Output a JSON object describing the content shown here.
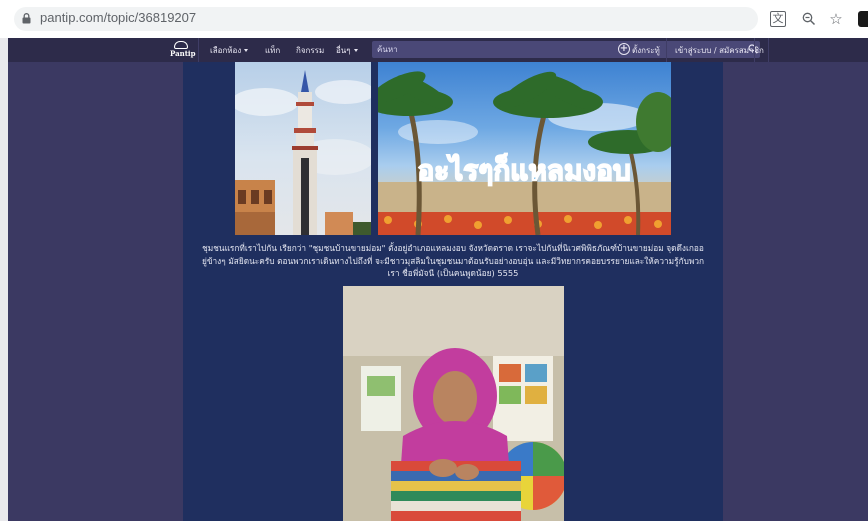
{
  "browser": {
    "url": "pantip.com/topic/36819207",
    "icons": [
      "lock-icon",
      "translate-icon",
      "zoom-icon",
      "bookmark-star-icon",
      "extension-icon"
    ]
  },
  "navbar": {
    "logo_text": "Pantip",
    "items": [
      {
        "label": "เลือกห้อง",
        "has_dropdown": true
      },
      {
        "label": "แท็ก",
        "has_dropdown": false
      },
      {
        "label": "กิจกรรม",
        "has_dropdown": false
      },
      {
        "label": "อื่นๆ",
        "has_dropdown": true
      }
    ],
    "search_placeholder": "ค้นหา",
    "create_topic_label": "ตั้งกระทู้",
    "login_label": "เข้าสู่ระบบ / สมัครสมาชิก"
  },
  "post": {
    "banner_overlay_text": "อะไรๆก็แหลมงอบ",
    "caption": "ชุมชนแรกที่เราไปกัน เรียกว่า \"ชุมชนบ้านขายม่อม\" ตั้งอยู่อำเภอแหลมงอบ จังหวัดตราด เราจะไปกันที่นิเวศพิพิธภัณฑ์บ้านขายม่อม จุดดึงเกออยู่ข้างๆ มัสยิดนะครับ ตอนพวกเราเดินทางไปถึงที่ จะมีชาวมุสลิมในชุมชนมาต้อนรับอย่างอบอุ่น และมีวิทยากรคอยบรรยายและให้ความรู้กับพวกเรา ชื่อพี่มัจนี (เป็นคนพูดน้อย) 5555"
  },
  "colors": {
    "site_background": "#3b3962",
    "navbar": "#2d2b4a",
    "content_column": "#1f2f5f"
  }
}
